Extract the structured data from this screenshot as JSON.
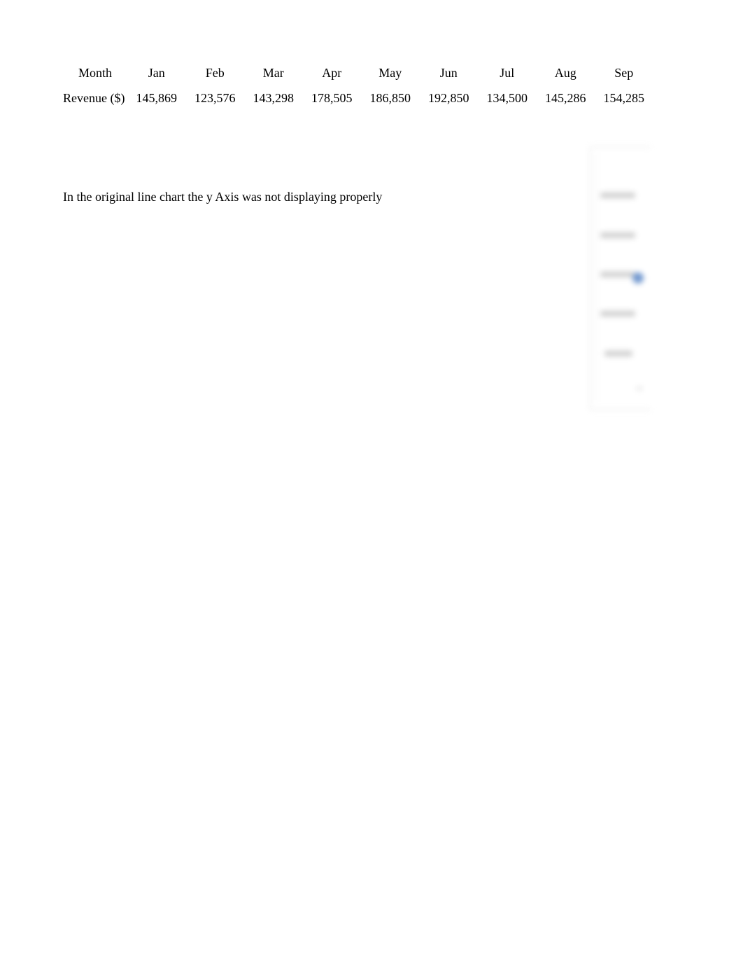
{
  "table": {
    "header_label": "Month",
    "row_label": "Revenue ($)",
    "months": [
      "Jan",
      "Feb",
      "Mar",
      "Apr",
      "May",
      "Jun",
      "Jul",
      "Aug",
      "Sep"
    ],
    "revenue": [
      "145,869",
      "123,576",
      "143,298",
      "178,505",
      "186,850",
      "192,850",
      "134,500",
      "145,286",
      "154,285"
    ]
  },
  "note": "In the original line chart the y Axis was not displaying properly",
  "chart_fragment": {
    "description": "Blurred, cropped line chart; y-axis tick labels illegible",
    "series_color": "#5b88c8",
    "frame_color": "#ececec"
  }
}
